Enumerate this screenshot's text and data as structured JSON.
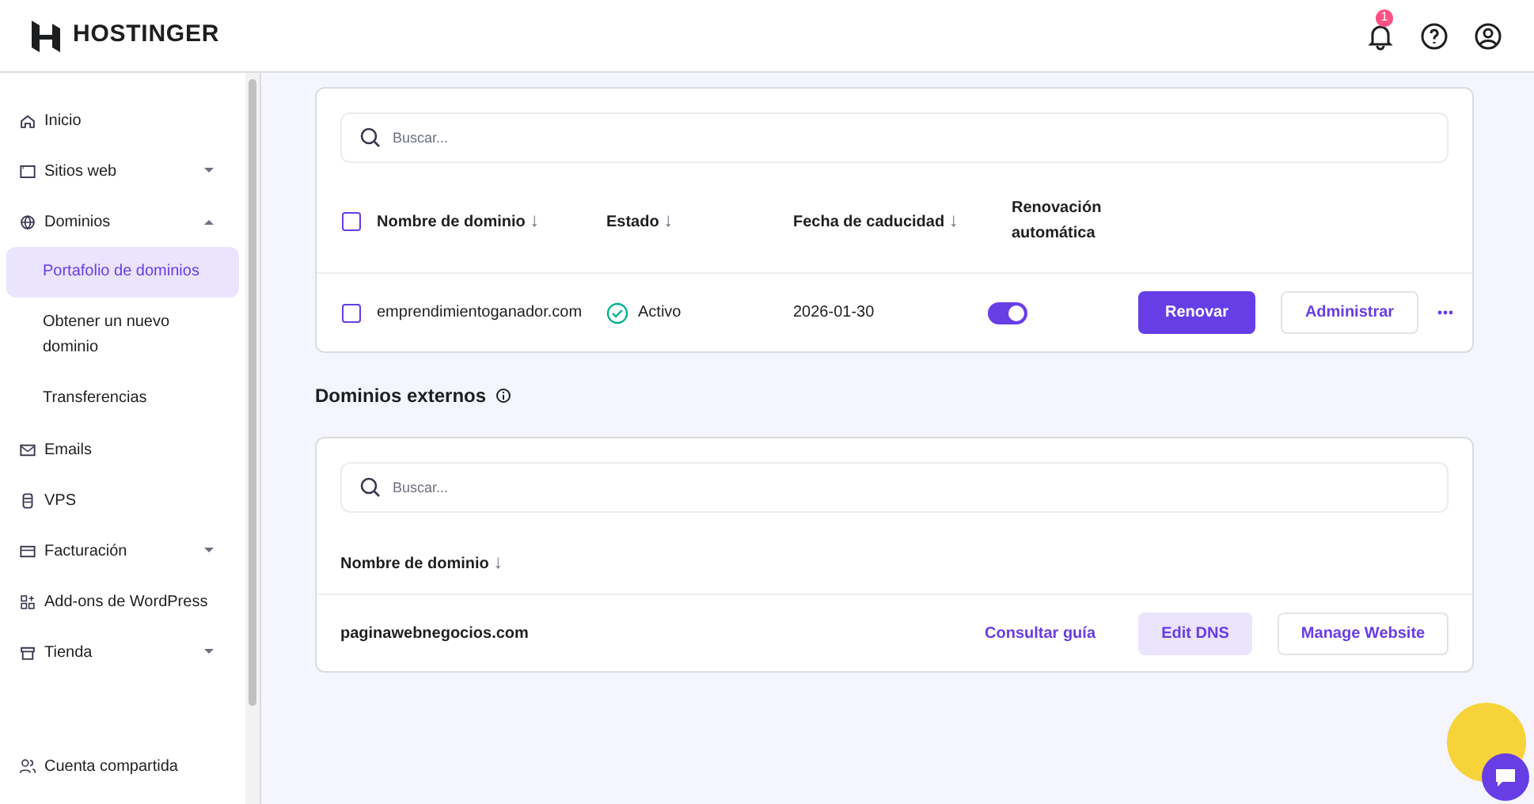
{
  "header": {
    "logo": "HOSTINGER",
    "notifications": "1"
  },
  "sidebar": {
    "items": [
      {
        "label": "Inicio"
      },
      {
        "label": "Sitios web",
        "expanded": false
      },
      {
        "label": "Dominios",
        "expanded": true,
        "children": [
          {
            "label": "Portafolio de dominios",
            "selected": true
          },
          {
            "label": "Obtener un nuevo dominio",
            "selected": false
          },
          {
            "label": "Transferencias",
            "selected": false
          }
        ]
      },
      {
        "label": "Emails"
      },
      {
        "label": "VPS"
      },
      {
        "label": "Facturación",
        "expanded": false
      },
      {
        "label": "Add-ons de WordPress"
      },
      {
        "label": "Tienda",
        "expanded": false
      }
    ],
    "footer": "Cuenta compartida"
  },
  "domains": {
    "search": {
      "placeholder": "Buscar..."
    },
    "select_all_checked": false,
    "columns": [
      {
        "label": "Nombre de dominio",
        "sort": "↓"
      },
      {
        "label": "Estado",
        "sort": "↓"
      },
      {
        "label": "Fecha de caducidad",
        "sort": "↓"
      },
      {
        "label": "Renovación automática"
      }
    ],
    "rows": [
      {
        "checked": false,
        "name": "emprendimientoganador.com",
        "status": "Activo",
        "expiry": "2026-01-30",
        "auto_renew": true,
        "actions": [
          "Renovar",
          "Administrar"
        ]
      }
    ]
  },
  "external": {
    "title": "Dominios externos",
    "search": {
      "placeholder": "Buscar..."
    },
    "columns": [
      {
        "label": "Nombre de dominio",
        "sort": "↓"
      }
    ],
    "rows": [
      {
        "name": "paginawebnegocios.com",
        "actions": [
          "Consultar guía",
          "Edit DNS",
          "Manage Website"
        ]
      }
    ]
  }
}
